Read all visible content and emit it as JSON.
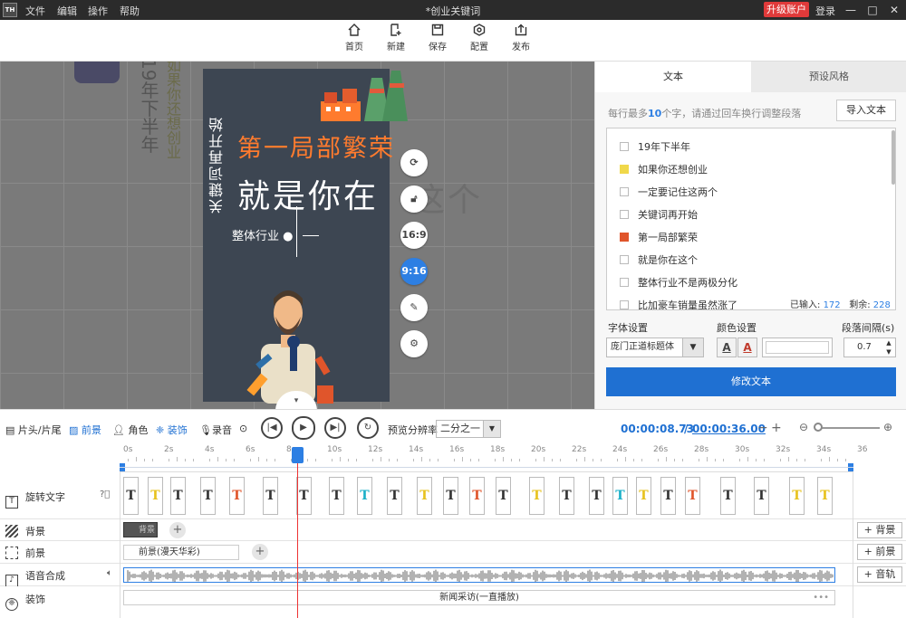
{
  "app": {
    "logo": "TH",
    "menus": [
      "文件",
      "编辑",
      "操作",
      "帮助"
    ],
    "title": "*创业关键词",
    "upgrade": "升级账户",
    "login": "登录"
  },
  "toolbar": {
    "items": [
      {
        "label": "首页",
        "icon": "home-icon"
      },
      {
        "label": "新建",
        "icon": "new-file-icon"
      },
      {
        "label": "保存",
        "icon": "save-icon"
      },
      {
        "label": "配置",
        "icon": "config-icon"
      },
      {
        "label": "发布",
        "icon": "publish-icon"
      }
    ]
  },
  "preview": {
    "vertical_text": "关键词再开始",
    "line1": "第一局部繁荣",
    "line2": "就是你在",
    "ghost": "这个",
    "line3": "整体行业 ●",
    "ghost_vertical_1": "19年下半年",
    "ghost_vertical_2": "如果你还想创业",
    "side_buttons": [
      "16:9",
      "9:16"
    ]
  },
  "panel": {
    "tabs": [
      "文本",
      "预设风格"
    ],
    "hint_prefix": "每行最多",
    "hint_num": "10",
    "hint_suffix": "个字，请通过回车换行调整段落",
    "import": "导入文本",
    "lines": [
      "19年下半年",
      "如果你还想创业",
      "一定要记住这两个",
      "关键词再开始",
      "第一局部繁荣",
      "就是你在这个",
      "整体行业不是两极分化",
      "比加豪车销量虽然涨了"
    ],
    "line_marks": [
      "",
      "#f0d84a",
      "",
      "",
      "#e0552b",
      "",
      "",
      ""
    ],
    "input_label": "已输入:",
    "input_count": "172",
    "remain_label": "剩余:",
    "remain_count": "228",
    "font_label": "字体设置",
    "font_value": "庞门正道标题体",
    "color_label": "颜色设置",
    "spacing_label": "段落间隔(s)",
    "spacing_value": "0.7",
    "modify": "修改文本"
  },
  "controls": {
    "head_tail": "片头/片尾",
    "foreground": "前景",
    "character": "角色",
    "decoration": "装饰",
    "record": "录音",
    "resolution_label": "预览分辨率",
    "resolution_value": "二分之一",
    "time_current": "00:00:08.73",
    "time_sep": "/",
    "time_total": "00:00:36.00"
  },
  "ruler": [
    "0s",
    "2s",
    "4s",
    "6s",
    "8s",
    "10s",
    "12s",
    "14s",
    "16s",
    "18s",
    "20s",
    "22s",
    "24s",
    "26s",
    "28s",
    "30s",
    "32s",
    "34s",
    "36"
  ],
  "tracks": {
    "rotate_text": "旋转文字",
    "background": "背景",
    "foreground": "前景",
    "voice": "语音合成",
    "decoration": "装饰",
    "bg_clip": "背景",
    "fg_clip": "前景(漫天华彩)",
    "deco_clip": "新闻采访(一直播放)",
    "add_bg": "+ 背景",
    "add_fg": "+ 前景",
    "add_audio": "+ 音轨"
  },
  "text_clips": {
    "positions": [
      136,
      163,
      188,
      221,
      253,
      290,
      327,
      363,
      394,
      427,
      460,
      489,
      518,
      547,
      584,
      617,
      650,
      676,
      702,
      729,
      756,
      795,
      832,
      871,
      902
    ],
    "colors": [
      "#333",
      "#e7c21e",
      "#333",
      "#333",
      "#e0552b",
      "#333",
      "#333",
      "#333",
      "#1bb0c8",
      "#333",
      "#e7c21e",
      "#333",
      "#e0552b",
      "#333",
      "#e7c21e",
      "#333",
      "#333",
      "#1bb0c8",
      "#e7c21e",
      "#333",
      "#e0552b",
      "#333",
      "#333",
      "#e7c21e",
      "#e7c21e"
    ],
    "glyph": "T"
  },
  "colors": {
    "accent": "#1f70d2",
    "panel_bg": "#3d4652",
    "orange": "#ff7b2e",
    "upgrade": "#e03a3a"
  }
}
